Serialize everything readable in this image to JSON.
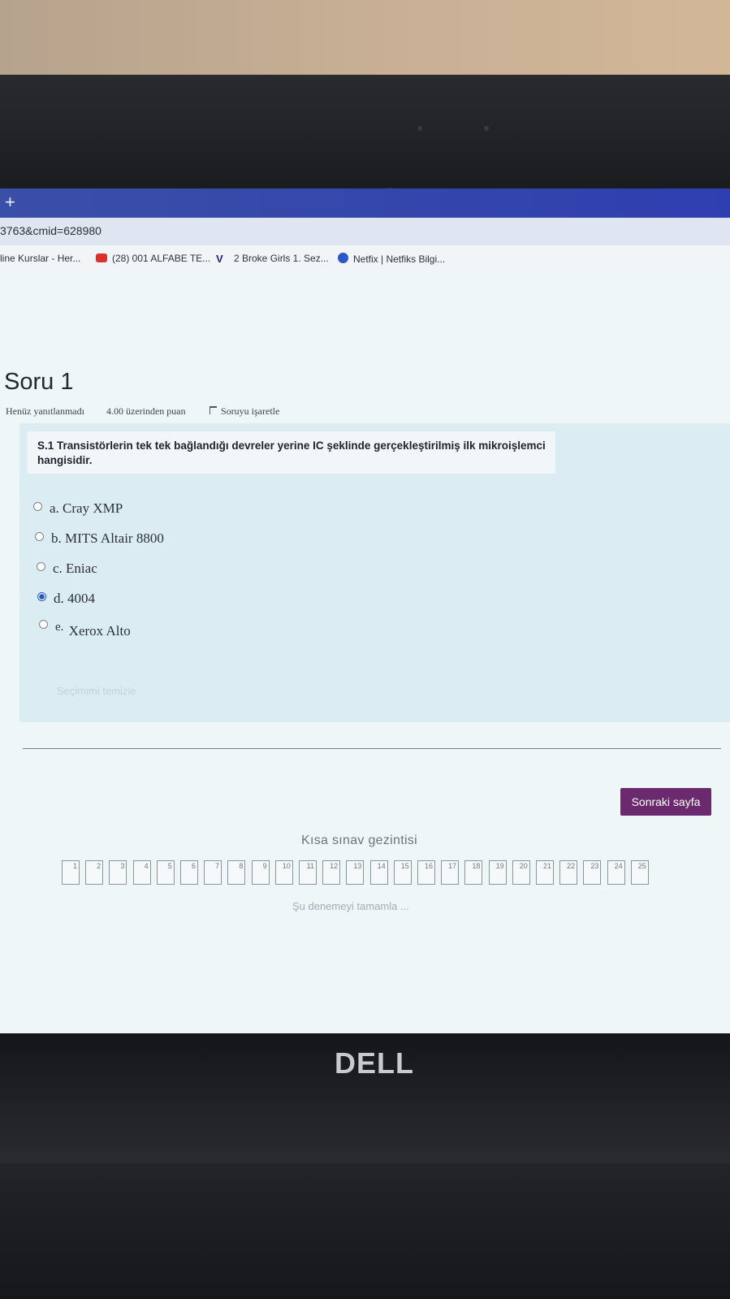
{
  "browser": {
    "new_tab_icon": "+",
    "url": "3763&cmid=628980",
    "bookmarks": [
      {
        "label": "line Kurslar - Her...",
        "icon": "page-icon"
      },
      {
        "label": "(28) 001 ALFABE TE...",
        "icon": "youtube-icon"
      },
      {
        "label": "2 Broke Girls 1. Sez...",
        "icon": "vimeo-icon"
      },
      {
        "label": "Netfix | Netfiks Bilgi...",
        "icon": "check-badge-icon"
      }
    ]
  },
  "question": {
    "title": "Soru 1",
    "status": "Henüz yanıtlanmadı",
    "points": "4.00 üzerinden puan",
    "flag_label": "Soruyu işaretle",
    "text": "S.1 Transistörlerin tek tek bağlandığı devreler yerine IC şeklinde gerçekleştirilmiş ilk mikroişlemci hangisidir.",
    "options": [
      {
        "label": "a. Cray XMP",
        "selected": false
      },
      {
        "label": "b. MITS Altair 8800",
        "selected": false
      },
      {
        "label": "c. Eniac",
        "selected": false
      },
      {
        "label": "d. 4004",
        "selected": true
      },
      {
        "label_prefix": "e.",
        "label_text": "Xerox Alto",
        "selected": false
      }
    ],
    "clear_selection": "Seçimimi temizle"
  },
  "navigation": {
    "next_button": "Sonraki sayfa",
    "quiz_nav_title": "Kısa sınav gezintisi",
    "pages": [
      "1",
      "2",
      "3",
      "4",
      "5",
      "6",
      "7",
      "8",
      "9",
      "10",
      "11",
      "12",
      "13",
      "14",
      "15",
      "16",
      "17",
      "18",
      "19",
      "20",
      "21",
      "22",
      "23",
      "24",
      "25"
    ],
    "finish_attempt": "Şu denemeyi tamamla ..."
  },
  "device": {
    "brand": "DELL"
  },
  "colors": {
    "tab_bar": "#2f3fb0",
    "next_button": "#6b2a6e",
    "selected_radio": "#2156c4",
    "taskbar": "#3d64b3"
  }
}
